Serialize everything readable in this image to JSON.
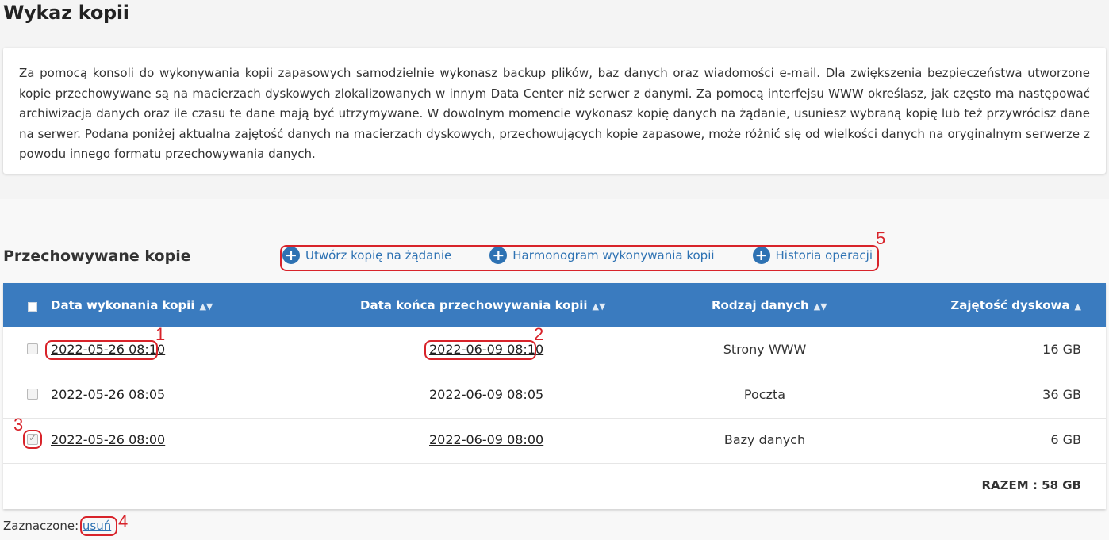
{
  "page": {
    "title": "Wykaz kopii",
    "info": "Za pomocą konsoli do wykonywania kopii zapasowych samodzielnie wykonasz backup plików, baz danych oraz wiadomości e-mail. Dla zwiększenia bezpieczeństwa utworzone kopie przechowywane są na macierzach dyskowych zlokalizowanych w innym Data Center niż serwer z danymi. Za pomocą interfejsu WWW określasz, jak często ma następować archiwizacja danych oraz ile czasu te dane mają być utrzymywane. W dowolnym momencie wykonasz kopię danych na żądanie, usuniesz wybraną kopię lub też przywrócisz dane na serwer. Podana poniżej aktualna zajętość danych na macierzach dyskowych, przechowujących kopie zapasowe, może różnić się od wielkości danych na oryginalnym serwerze z powodu innego formatu przechowywania danych."
  },
  "section": {
    "title": "Przechowywane kopie",
    "actions": [
      {
        "label": "Utwórz kopię na żądanie",
        "icon": "plus-circle-icon"
      },
      {
        "label": "Harmonogram wykonywania kopii",
        "icon": "plus-circle-icon"
      },
      {
        "label": "Historia operacji",
        "icon": "plus-circle-icon"
      }
    ]
  },
  "table": {
    "headers": [
      "Data wykonania kopii",
      "Data końca przechowywania kopii",
      "Rodzaj danych",
      "Zajętość dyskowa"
    ],
    "sort_icon": "sort-arrows-icon",
    "rows": [
      {
        "created": "2022-05-26 08:10",
        "expires": "2022-06-09 08:10",
        "type": "Strony WWW",
        "size": "16 GB",
        "checked": false
      },
      {
        "created": "2022-05-26 08:05",
        "expires": "2022-06-09 08:05",
        "type": "Poczta",
        "size": "36 GB",
        "checked": false
      },
      {
        "created": "2022-05-26 08:00",
        "expires": "2022-06-09 08:00",
        "type": "Bazy danych",
        "size": "6 GB",
        "checked": true
      }
    ],
    "total": "RAZEM : 58 GB"
  },
  "footer": {
    "label": "Zaznaczone:",
    "delete_link": "usuń"
  },
  "annotations": [
    "1",
    "2",
    "3",
    "4",
    "5"
  ],
  "colors": {
    "accent": "#3a7bbf",
    "link": "#2e72b3",
    "annotation": "#d8232a"
  }
}
